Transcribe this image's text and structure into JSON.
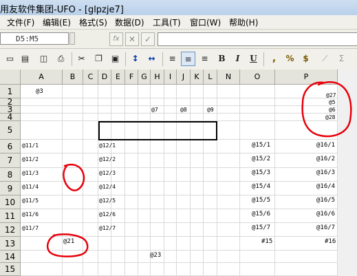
{
  "window": {
    "title": "用友软件集团-UFO - [glpzje7]"
  },
  "menu": [
    {
      "label": "文件(F)"
    },
    {
      "label": "编辑(E)"
    },
    {
      "label": "格式(S)"
    },
    {
      "label": "数据(D)"
    },
    {
      "label": "工具(T)"
    },
    {
      "label": "窗口(W)"
    },
    {
      "label": "帮助(H)"
    }
  ],
  "formula_bar": {
    "cell_ref": "D5:M5",
    "fx_label": "fx",
    "cancel_symbol": "✕",
    "confirm_symbol": "✓",
    "formula_value": ""
  },
  "toolbar": {
    "buttons": [
      {
        "icon": "new-file-icon",
        "glyph": "▭"
      },
      {
        "icon": "save-icon",
        "glyph": "▤"
      },
      {
        "icon": "print-preview-icon",
        "glyph": "◫"
      },
      {
        "icon": "print-icon",
        "glyph": "⎙"
      },
      {
        "icon": "cut-icon",
        "glyph": "✂"
      },
      {
        "icon": "copy-icon",
        "glyph": "❐"
      },
      {
        "icon": "paste-icon",
        "glyph": "▣"
      },
      {
        "icon": "row-height-icon",
        "glyph": "↕"
      },
      {
        "icon": "column-width-icon",
        "glyph": "↔"
      },
      {
        "icon": "align-left-icon",
        "glyph": "≡"
      },
      {
        "icon": "align-center-icon",
        "glyph": "≡"
      },
      {
        "icon": "align-right-icon",
        "glyph": "≡"
      },
      {
        "icon": "bold-icon",
        "glyph": "B"
      },
      {
        "icon": "italic-icon",
        "glyph": "I"
      },
      {
        "icon": "underline-icon",
        "glyph": "U"
      },
      {
        "icon": "comma-icon",
        "glyph": ","
      },
      {
        "icon": "percent-icon",
        "glyph": "%"
      },
      {
        "icon": "currency-icon",
        "glyph": "$"
      },
      {
        "icon": "chart-icon",
        "glyph": "⟋"
      },
      {
        "icon": "sum-icon",
        "glyph": "Σ"
      }
    ]
  },
  "sheet": {
    "columns": [
      "A",
      "B",
      "C",
      "D",
      "E",
      "F",
      "G",
      "H",
      "I",
      "J",
      "K",
      "L",
      "N",
      "O",
      "P"
    ],
    "rows": [
      "1",
      "2",
      "3",
      "4",
      "5",
      "6",
      "7",
      "8",
      "9",
      "10",
      "11",
      "12",
      "13",
      "14",
      "15"
    ],
    "cells": {
      "a1": "@3",
      "p1": "@27",
      "p2": "@5",
      "h3": "@7",
      "j3": "@8",
      "l3": "@9",
      "p3": "@6",
      "p4": "@28",
      "a6": "@11/1",
      "d6": "@12/1",
      "o6": "@15/1",
      "p6": "@16/1",
      "a7": "@11/2",
      "d7": "@12/2",
      "o7": "@15/2",
      "p7": "@16/2",
      "a8": "@11/3",
      "d8": "@12/3",
      "o8": "@15/3",
      "p8": "@16/3",
      "a9": "@11/4",
      "d9": "@12/4",
      "o9": "@15/4",
      "p9": "@16/4",
      "a10": "@11/5",
      "d10": "@12/5",
      "o10": "@15/5",
      "p10": "@16/5",
      "a11": "@11/6",
      "d11": "@12/6",
      "o11": "@15/6",
      "p11": "@16/6",
      "a12": "@11/7",
      "d12": "@12/7",
      "o12": "@15/7",
      "p12": "@16/7",
      "b13": "@21",
      "o13": "#15",
      "p13": "#16",
      "h14": "@23"
    }
  },
  "annotations": {
    "color": "#e8000a"
  }
}
